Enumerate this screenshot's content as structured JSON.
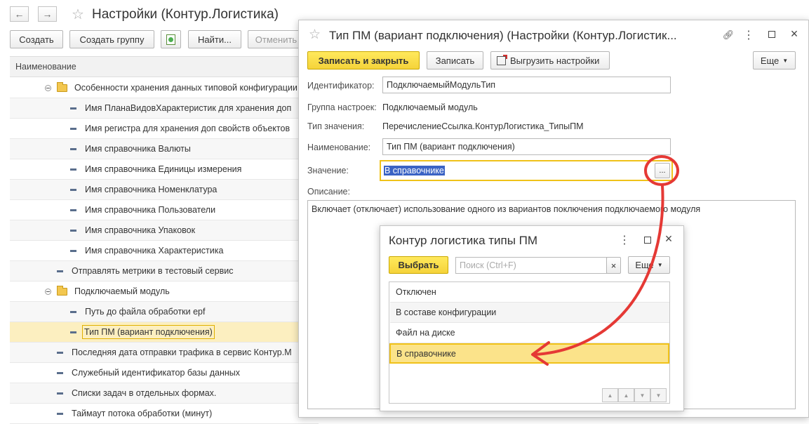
{
  "main": {
    "title": "Настройки (Контур.Логистика)",
    "toolbar": {
      "create": "Создать",
      "create_group": "Создать группу",
      "find": "Найти...",
      "cancel": "Отменить"
    },
    "column_header": "Наименование",
    "rows": [
      {
        "label": "Особенности хранения данных типовой конфигурации"
      },
      {
        "label": "Имя ПланаВидовХарактеристик для хранения доп"
      },
      {
        "label": "Имя регистра для хранения доп свойств объектов"
      },
      {
        "label": "Имя справочника Валюты"
      },
      {
        "label": "Имя справочника Единицы измерения"
      },
      {
        "label": "Имя справочника Номенклатура"
      },
      {
        "label": "Имя справочника Пользователи"
      },
      {
        "label": "Имя справочника Упаковок"
      },
      {
        "label": "Имя справочника Характеристика"
      },
      {
        "label": "Отправлять метрики в тестовый сервис"
      },
      {
        "label": "Подключаемый модуль"
      },
      {
        "label": "Путь до файла обработки epf"
      },
      {
        "label": "Тип ПМ (вариант подключения)"
      },
      {
        "label": "Последняя дата отправки трафика в сервис Контур.М"
      },
      {
        "label": "Служебный идентификатор базы данных"
      },
      {
        "label": "Списки задач в отдельных формах."
      },
      {
        "label": "Таймаут потока обработки (минут)"
      }
    ]
  },
  "form": {
    "title": "Тип ПМ (вариант подключения) (Настройки (Контур.Логистик...",
    "save_close": "Записать и закрыть",
    "save": "Записать",
    "export": "Выгрузить настройки",
    "more": "Еще",
    "id_label": "Идентификатор:",
    "id_value": "ПодключаемыйМодульТип",
    "group_label": "Группа настроек:",
    "group_value": "Подключаемый модуль",
    "type_label": "Тип значения:",
    "type_value": "ПеречислениеСсылка.КонтурЛогистика_ТипыПМ",
    "name_label": "Наименование:",
    "name_value": "Тип ПМ (вариант подключения)",
    "value_label": "Значение:",
    "value_value": "В справочнике",
    "select_btn": "...",
    "desc_label": "Описание:",
    "desc_value": "Включает (отключает) использование одного из вариантов поключения подключаемого модуля"
  },
  "picker": {
    "title": "Контур логистика типы ПМ",
    "select": "Выбрать",
    "search_placeholder": "Поиск (Ctrl+F)",
    "clear": "×",
    "more": "Еще",
    "items": [
      {
        "label": "Отключен"
      },
      {
        "label": "В составе конфигурации"
      },
      {
        "label": "Файл на диске"
      },
      {
        "label": "В справочнике"
      }
    ]
  },
  "colors": {
    "accent_yellow": "#f5d33a",
    "selection_blue": "#3b63c4",
    "annotation_red": "#e53935"
  }
}
